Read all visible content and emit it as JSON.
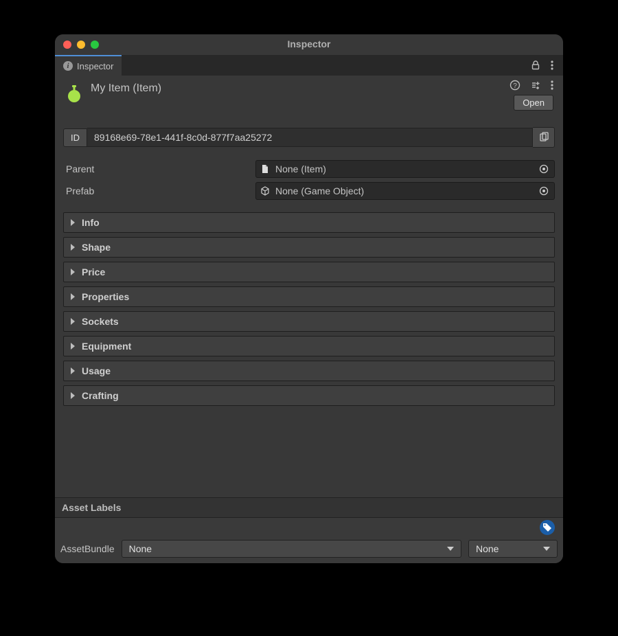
{
  "window": {
    "title": "Inspector"
  },
  "tab": {
    "label": "Inspector"
  },
  "header": {
    "title": "My Item (Item)",
    "open_button": "Open"
  },
  "id": {
    "label": "ID",
    "value": "89168e69-78e1-441f-8c0d-877f7aa25272"
  },
  "fields": {
    "parent": {
      "label": "Parent",
      "value": "None (Item)"
    },
    "prefab": {
      "label": "Prefab",
      "value": "None (Game Object)"
    }
  },
  "foldouts": [
    "Info",
    "Shape",
    "Price",
    "Properties",
    "Sockets",
    "Equipment",
    "Usage",
    "Crafting"
  ],
  "footer": {
    "asset_labels_header": "Asset Labels",
    "asset_bundle_label": "AssetBundle",
    "bundle_name": "None",
    "bundle_variant": "None"
  }
}
